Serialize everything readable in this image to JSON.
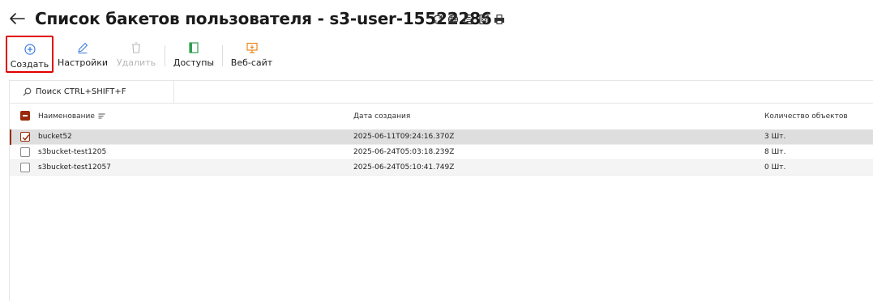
{
  "header": {
    "title": "Список бакетов пользователя - s3-user-15522286",
    "icons": [
      "refresh-icon",
      "globe-icon",
      "export-icon",
      "export-excel-icon",
      "print-icon"
    ]
  },
  "toolbar": {
    "create_label": "Создать",
    "settings_label": "Настройки",
    "delete_label": "Удалить",
    "access_label": "Доступы",
    "website_label": "Веб-сайт"
  },
  "search": {
    "placeholder": "Поиск CTRL+SHIFT+F"
  },
  "table": {
    "columns": {
      "name": "Наименование",
      "created": "Дата создания",
      "count": "Количество объектов"
    },
    "rows": [
      {
        "name": "bucket52",
        "created": "2025-06-11T09:24:16.370Z",
        "count": "3 Шт.",
        "checked": true
      },
      {
        "name": "s3bucket-test1205",
        "created": "2025-06-24T05:03:18.239Z",
        "count": "8 Шт.",
        "checked": false
      },
      {
        "name": "s3bucket-test12057",
        "created": "2025-06-24T05:10:41.749Z",
        "count": "0 Шт.",
        "checked": false
      }
    ]
  },
  "colors": {
    "accent": "#9a2b0a",
    "create_icon": "#3b7ddd",
    "access_icon": "#2e9e4f",
    "website_icon": "#e8891c",
    "highlight_border": "#e00000"
  }
}
